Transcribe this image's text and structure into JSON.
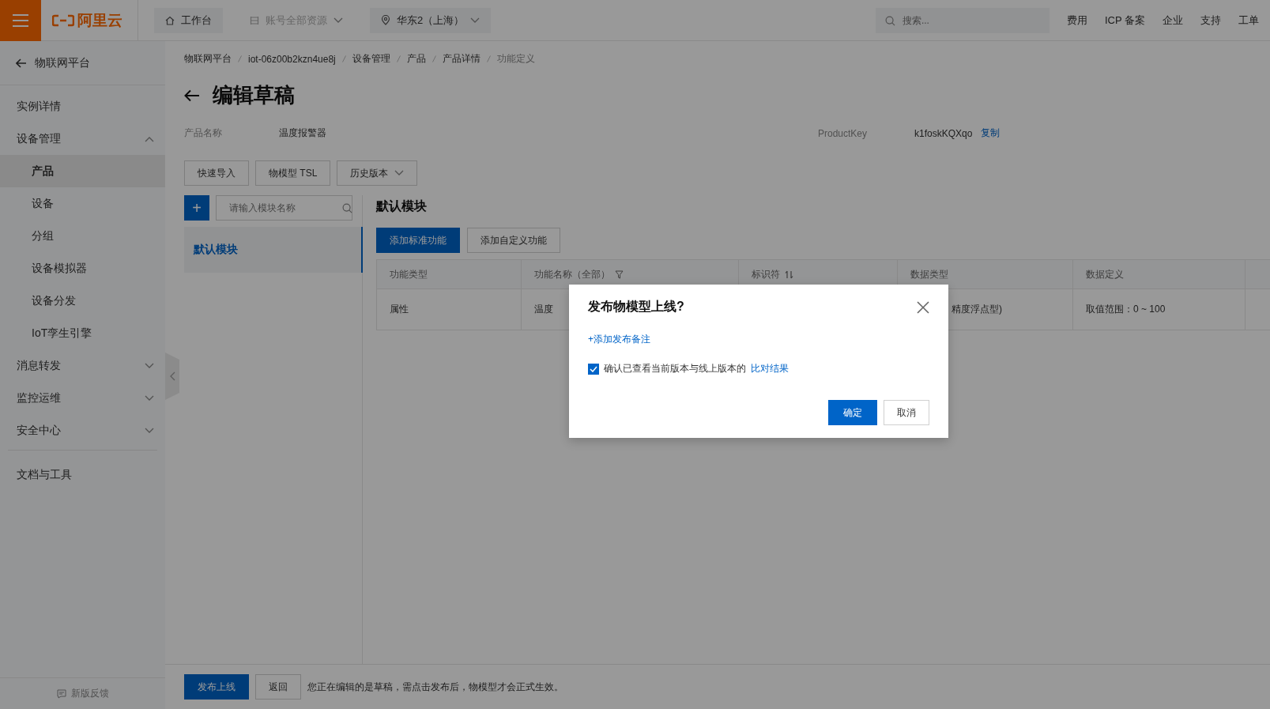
{
  "topbar": {
    "logo": "阿里云",
    "nav": [
      {
        "label": "工作台",
        "kind": "home",
        "disabled": false
      },
      {
        "label": "账号全部资源",
        "kind": "resources",
        "disabled": true
      },
      {
        "label": "华东2（上海）",
        "kind": "region",
        "disabled": false
      }
    ],
    "search": {
      "placeholder": "搜索..."
    },
    "links": [
      "费用",
      "ICP 备案",
      "企业",
      "支持",
      "工单"
    ]
  },
  "sidebar": {
    "back": "物联网平台",
    "items": [
      {
        "label": "实例详情"
      },
      {
        "label": "设备管理",
        "expanded": true,
        "children": [
          {
            "label": "产品",
            "selected": true
          },
          {
            "label": "设备",
            "selected": false
          },
          {
            "label": "分组",
            "selected": false
          },
          {
            "label": "设备模拟器",
            "selected": false
          },
          {
            "label": "设备分发",
            "selected": false
          },
          {
            "label": "IoT孪生引擎",
            "selected": false
          }
        ]
      },
      {
        "label": "消息转发",
        "expanded": false
      },
      {
        "label": "监控运维",
        "expanded": false
      },
      {
        "label": "安全中心",
        "expanded": false
      }
    ],
    "extra": "文档与工具",
    "feedback": "新版反馈"
  },
  "breadcrumb": [
    "物联网平台",
    "iot-06z00b2kzn4ue8j",
    "设备管理",
    "产品",
    "产品详情",
    "功能定义"
  ],
  "title": "编辑草稿",
  "info": {
    "name_label": "产品名称",
    "name": "温度报警器",
    "key_label": "ProductKey",
    "key": "k1foskKQXqo",
    "copy": "复制"
  },
  "toolbar": [
    {
      "label": "快速导入",
      "dropdown": false
    },
    {
      "label": "物模型 TSL",
      "dropdown": false
    },
    {
      "label": "历史版本",
      "dropdown": true
    }
  ],
  "modules": {
    "add": "+",
    "placeholder": "请输入模块名称",
    "items": [
      {
        "label": "默认模块",
        "selected": true
      }
    ]
  },
  "section": {
    "title": "默认模块",
    "buttons": [
      {
        "label": "添加标准功能",
        "primary": true
      },
      {
        "label": "添加自定义功能",
        "primary": false
      }
    ]
  },
  "table": {
    "columns": [
      "功能类型",
      "功能名称（全部）",
      "标识符",
      "数据类型",
      "数据定义"
    ],
    "rows": [
      [
        "属性",
        "温度",
        "",
        "精度浮点型)",
        "取值范围：0 ~ 100"
      ]
    ]
  },
  "footer": {
    "publish": "发布上线",
    "back": "返回",
    "note": "您正在编辑的是草稿，需点击发布后，物模型才会正式生效。"
  },
  "dialog": {
    "title": "发布物模型上线?",
    "add_note": "+添加发布备注",
    "confirm": {
      "checked": true,
      "label": "确认已查看当前版本与线上版本的",
      "link": "比对结果"
    },
    "ok": "确定",
    "cancel": "取消"
  }
}
